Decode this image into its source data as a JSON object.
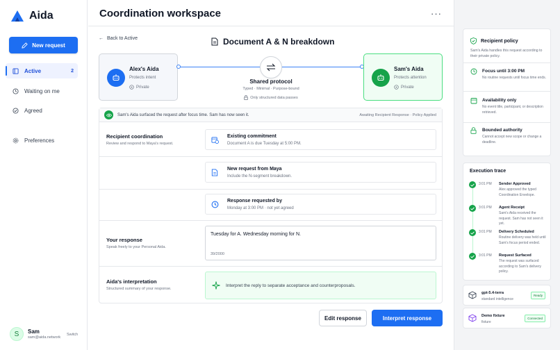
{
  "app": {
    "name": "Aida"
  },
  "sidebar": {
    "new_request": "New request",
    "items": [
      {
        "label": "Active",
        "count": "2"
      },
      {
        "label": "Waiting on me"
      },
      {
        "label": "Agreed"
      },
      {
        "label": "Preferences"
      }
    ],
    "user": {
      "initial": "S",
      "name": "Sam",
      "email": "sam@aida.network",
      "switch": "Switch"
    }
  },
  "header": {
    "title": "Coordination workspace",
    "more": "···"
  },
  "main": {
    "back": "Back to Active",
    "doc_title": "Document A & N breakdown",
    "sender": {
      "name": "Alex's Aida",
      "sub": "Protects intent",
      "privacy": "Private"
    },
    "recipient": {
      "name": "Sam's Aida",
      "sub": "Protects attention",
      "privacy": "Private"
    },
    "protocol": {
      "title": "Shared protocol",
      "sub": "Typed · Minimal · Purpose-bound",
      "note": "Only structured data passes"
    },
    "banner": {
      "text": "Sam's Aida surfaced the request after focus time. Sam has now seen it.",
      "status": "Awaiting Recipient Response · Policy Applied"
    },
    "coordination": {
      "label": "Recipient coordination",
      "desc": "Review and respond to Maya's request.",
      "items": [
        {
          "title": "Existing commitment",
          "sub": "Document A is due Tuesday at 5:00 PM."
        },
        {
          "title": "New request from Maya",
          "sub": "Include the N-segment breakdown."
        },
        {
          "title": "Response requested by",
          "sub": "Monday at 3:00 PM · not yet agreed"
        }
      ]
    },
    "response": {
      "label": "Your response",
      "desc": "Speak freely to your Personal Aida.",
      "value": "Tuesday for A. Wednesday morning for N.",
      "counter": "39/2000"
    },
    "interpretation": {
      "label": "Aida's interpretation",
      "desc": "Structured summary of your response.",
      "text": "Interpret the reply to separate acceptance and counterproposals."
    },
    "buttons": {
      "edit": "Edit response",
      "interpret": "Interpret response"
    }
  },
  "policy": {
    "title": "Recipient policy",
    "text": "Sam's Aida handles this request according to their private policy.",
    "rows": [
      {
        "title": "Focus until 3:00 PM",
        "desc": "No routine requests until focus time ends."
      },
      {
        "title": "Availability only",
        "desc": "No event title, participant, or description retrieved."
      },
      {
        "title": "Bounded authority",
        "desc": "Cannot accept new scope or change a deadline."
      }
    ]
  },
  "trace": {
    "title": "Execution trace",
    "events": [
      {
        "time": "3:01 PM",
        "name": "Sender Approved",
        "desc": "Alex approved the typed Coordination Envelope."
      },
      {
        "time": "3:01 PM",
        "name": "Agent Receipt",
        "desc": "Sam's Aida received the request. Sam has not seen it yet."
      },
      {
        "time": "3:01 PM",
        "name": "Delivery Scheduled",
        "desc": "Routine delivery was held until Sam's focus period ended."
      },
      {
        "time": "3:01 PM",
        "name": "Request Surfaced",
        "desc": "The request was surfaced according to Sam's delivery policy."
      }
    ]
  },
  "models": [
    {
      "name": "gpt-5.4-terra",
      "sub": "standard intelligence",
      "badge": "Ready"
    },
    {
      "name": "Demo fixture",
      "sub": "fixture",
      "badge": "Connected"
    }
  ],
  "colors": {
    "accent": "#1d6ef2",
    "success": "#16a34a"
  }
}
